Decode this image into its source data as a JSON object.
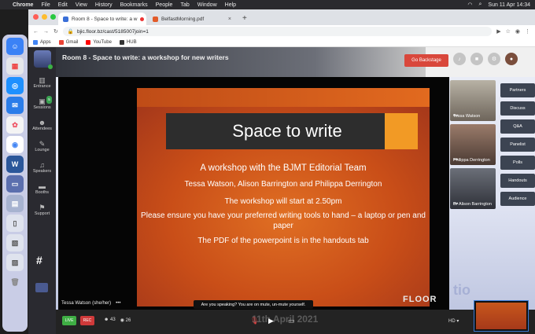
{
  "menubar": {
    "items": [
      "Chrome",
      "File",
      "Edit",
      "View",
      "History",
      "Bookmarks",
      "People",
      "Tab",
      "Window",
      "Help"
    ],
    "clock": "Sun 11 Apr 14:34"
  },
  "tabs": [
    {
      "label": "Room 8 - Space to write: a w"
    },
    {
      "label": "BelfastMorning.pdf"
    }
  ],
  "address": {
    "url": "bjic.floor.bz/cast/5185007join=1"
  },
  "bookmarks": [
    "Apps",
    "Gmail",
    "YouTube",
    "HUB"
  ],
  "nav": {
    "items": [
      {
        "label": "Entrance"
      },
      {
        "label": "Sessions",
        "badge": "5"
      },
      {
        "label": "Attendees"
      },
      {
        "label": "Lounge"
      },
      {
        "label": "Speakers"
      },
      {
        "label": "Booths"
      },
      {
        "label": "Support"
      }
    ],
    "hash": "#"
  },
  "room": {
    "title": "Room 8 - Space to write: a workshop for new writers"
  },
  "backstage_label": "Go Backstage",
  "slide": {
    "title": "Space to write",
    "line1": "A workshop with the BJMT Editorial Team",
    "line2": "Tessa Watson, Alison Barrington and Philippa Derrington",
    "line3": "The workshop will start at 2.50pm",
    "line4": "Please ensure you have your preferred writing tools to hand – a laptop or pen and paper",
    "line5": "The PDF of the powerpoint is in the handouts tab"
  },
  "presenter": "Tessa Watson (she/her)",
  "presenter_dots": "•••",
  "notice": "Are you speaking? You are on mute, un-mute yourself.",
  "watermark": "FLOOR",
  "videos": [
    {
      "name": "Tessa Watson",
      "dots": "•••"
    },
    {
      "name": "Philippa Derrington",
      "dots": "•••"
    },
    {
      "name": "Dr Alison Barrington",
      "dots": "•••"
    }
  ],
  "right_buttons": [
    "Partners",
    "Discuss",
    "Q&A",
    "Panelist",
    "Polls",
    "Handouts",
    "Audience"
  ],
  "bottom": {
    "live": "LIVE",
    "rec": "REC",
    "people": "43",
    "views": "26",
    "date_overlay": "11th April 2021",
    "quality": "HD"
  },
  "colors": {
    "live": "#3fae44",
    "rec": "#cf3a3a",
    "backstage": "#d9473b",
    "slide": "#c94e18",
    "accent": "#f29a25"
  }
}
